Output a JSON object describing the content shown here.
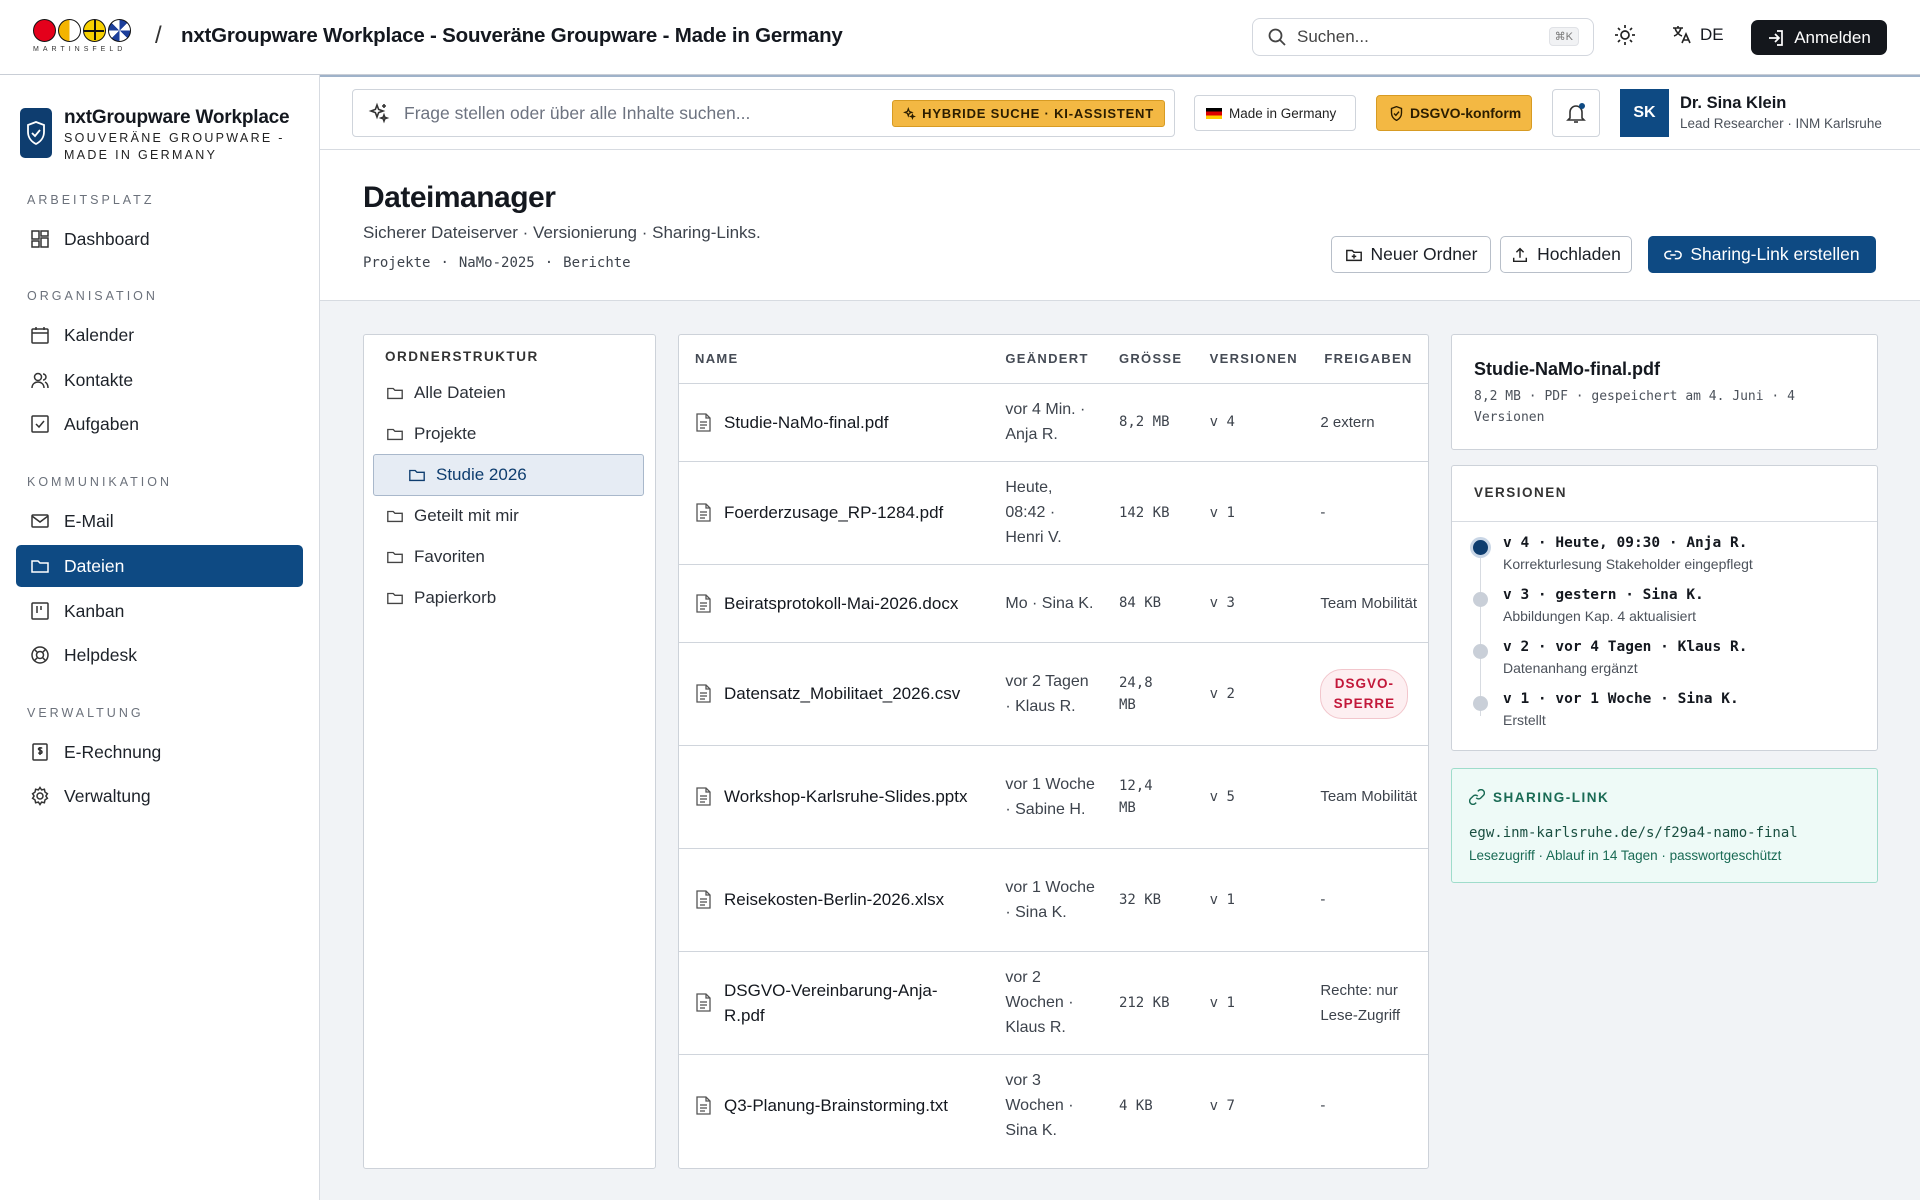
{
  "topbar": {
    "logo_word": "MARTINSFELD",
    "app_title": "nxtGroupware Workplace - Souveräne Groupware - Made in Germany",
    "search_placeholder": "Suchen...",
    "search_shortcut": "⌘K",
    "language": "DE",
    "login_label": "Anmelden"
  },
  "sidebar": {
    "brand_name": "nxtGroupware Workplace",
    "brand_sub": "SOUVERÄNE GROUPWARE - MADE IN GERMANY",
    "sections": [
      {
        "title": "ARBEITSPLATZ",
        "items": [
          {
            "label": "Dashboard",
            "icon": "dashboard-icon"
          }
        ]
      },
      {
        "title": "ORGANISATION",
        "items": [
          {
            "label": "Kalender",
            "icon": "calendar-icon"
          },
          {
            "label": "Kontakte",
            "icon": "contacts-icon"
          },
          {
            "label": "Aufgaben",
            "icon": "tasks-icon"
          }
        ]
      },
      {
        "title": "KOMMUNIKATION",
        "items": [
          {
            "label": "E-Mail",
            "icon": "mail-icon"
          },
          {
            "label": "Dateien",
            "icon": "folder-icon",
            "active": true
          },
          {
            "label": "Kanban",
            "icon": "kanban-icon"
          },
          {
            "label": "Helpdesk",
            "icon": "lifebuoy-icon"
          }
        ]
      },
      {
        "title": "VERWALTUNG",
        "items": [
          {
            "label": "E-Rechnung",
            "icon": "invoice-icon"
          },
          {
            "label": "Verwaltung",
            "icon": "gear-icon"
          }
        ]
      }
    ]
  },
  "subbar": {
    "ask_placeholder": "Frage stellen oder über alle Inhalte suchen...",
    "hybrid_badge": "HYBRIDE SUCHE · KI-ASSISTENT",
    "made_in_germany": "Made in Germany",
    "dsgvo": "DSGVO-konform",
    "user_initials": "SK",
    "user_name": "Dr. Sina Klein",
    "user_role": "Lead Researcher · INM Karlsruhe"
  },
  "page": {
    "title": "Dateimanager",
    "subtitle": "Sicherer Dateiserver · Versionierung · Sharing-Links.",
    "breadcrumb": [
      "Projekte",
      "·",
      "NaMo-2025",
      "·",
      "Berichte"
    ],
    "btn_new_folder": "Neuer Ordner",
    "btn_upload": "Hochladen",
    "btn_share": "Sharing-Link erstellen"
  },
  "tree": {
    "title": "ORDNERSTRUKTUR",
    "items": [
      {
        "label": "Alle Dateien",
        "indent": 0
      },
      {
        "label": "Projekte",
        "indent": 0
      },
      {
        "label": "Studie 2026",
        "indent": 1,
        "selected": true
      },
      {
        "label": "Geteilt mit mir",
        "indent": 0
      },
      {
        "label": "Favoriten",
        "indent": 0
      },
      {
        "label": "Papierkorb",
        "indent": 0
      }
    ]
  },
  "files": {
    "columns": [
      "NAME",
      "GEÄNDERT",
      "GRÖSSE",
      "VERSIONEN",
      "FREIGABEN"
    ],
    "rows": [
      {
        "name": "Studie-NaMo-final.pdf",
        "changed": "vor 4 Min. · Anja R.",
        "size": "8,2 MB",
        "versions": "v 4",
        "share": "2 extern"
      },
      {
        "name": "Foerderzusage_RP-1284.pdf",
        "changed": "Heute, 08:42 · Henri V.",
        "size": "142 KB",
        "versions": "v 1",
        "share": "-"
      },
      {
        "name": "Beiratsprotokoll-Mai-2026.docx",
        "changed": "Mo · Sina K.",
        "size": "84 KB",
        "versions": "v 3",
        "share": "Team Mobilität"
      },
      {
        "name": "Datensatz_Mobilitaet_2026.csv",
        "changed": "vor 2 Tagen · Klaus R.",
        "size": "24,8 MB",
        "versions": "v 2",
        "share": "DSGVO-SPERRE",
        "share_badge": true
      },
      {
        "name": "Workshop-Karlsruhe-Slides.pptx",
        "changed": "vor 1 Woche · Sabine H.",
        "size": "12,4 MB",
        "versions": "v 5",
        "share": "Team Mobilität"
      },
      {
        "name": "Reisekosten-Berlin-2026.xlsx",
        "changed": "vor 1 Woche · Sina K.",
        "size": "32 KB",
        "versions": "v 1",
        "share": "-"
      },
      {
        "name": "DSGVO-Vereinbarung-Anja-R.pdf",
        "changed": "vor 2 Wochen · Klaus R.",
        "size": "212 KB",
        "versions": "v 1",
        "share": "Rechte: nur Lese-Zugriff"
      },
      {
        "name": "Q3-Planung-Brainstorming.txt",
        "changed": "vor 3 Wochen · Sina K.",
        "size": "4 KB",
        "versions": "v 7",
        "share": "-"
      }
    ]
  },
  "detail": {
    "file_name": "Studie-NaMo-final.pdf",
    "file_meta": "8,2 MB · PDF · gespeichert am 4. Juni · 4 Versionen",
    "versions_title": "VERSIONEN",
    "versions": [
      {
        "head": "v 4 · Heute, 09:30 · Anja R.",
        "desc": "Korrekturlesung Stakeholder eingepflegt",
        "current": true
      },
      {
        "head": "v 3 · gestern · Sina K.",
        "desc": "Abbildungen Kap. 4 aktualisiert"
      },
      {
        "head": "v 2 · vor 4 Tagen · Klaus R.",
        "desc": "Datenanhang ergänzt"
      },
      {
        "head": "v 1 · vor 1 Woche · Sina K.",
        "desc": "Erstellt"
      }
    ],
    "share_title": "SHARING-LINK",
    "share_url": "egw.inm-karlsruhe.de/s/f29a4-namo-final",
    "share_info": "Lesezugriff · Ablauf in 14 Tagen · passwortgeschützt"
  },
  "colors": {
    "primary": "#0e4a83",
    "accent": "#f3b843",
    "danger": "#c2183a",
    "share_bg": "#eefaf7"
  }
}
